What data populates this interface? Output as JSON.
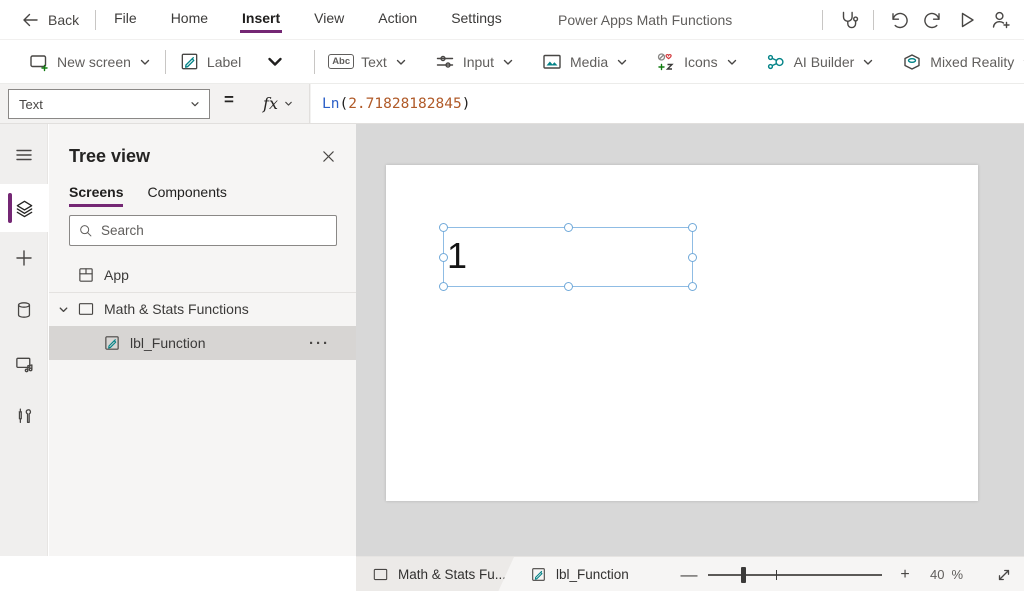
{
  "colors": {
    "accent_purple": "#742774",
    "icon_teal": "#038387",
    "selection_blue": "#70a9d9",
    "formula_function_blue": "#2b5fc7",
    "formula_number_orange": "#b05a28",
    "canvas_gray": "#d8d8d8"
  },
  "menubar": {
    "back_label": "Back",
    "items": [
      {
        "label": "File"
      },
      {
        "label": "Home"
      },
      {
        "label": "Insert",
        "active": true
      },
      {
        "label": "View"
      },
      {
        "label": "Action"
      },
      {
        "label": "Settings"
      }
    ],
    "title": "Power Apps Math Functions"
  },
  "ribbon": {
    "new_screen_label": "New screen",
    "label_label": "Label",
    "abc_glyph": "Abc",
    "text_label": "Text",
    "input_label": "Input",
    "media_label": "Media",
    "icons_label": "Icons",
    "ai_builder_label": "AI Builder",
    "mixed_reality_label": "Mixed Reality"
  },
  "formula_bar": {
    "property_selected": "Text",
    "equals_sign": "=",
    "fx_label": "fx",
    "formula": {
      "function": "Ln",
      "open_paren": "(",
      "number": "2.71828182845",
      "close_paren": ")"
    }
  },
  "tree_panel": {
    "title": "Tree view",
    "tabs": [
      {
        "label": "Screens",
        "active": true
      },
      {
        "label": "Components"
      }
    ],
    "search_placeholder": "Search",
    "items": {
      "app_label": "App",
      "screen_label": "Math & Stats Functions",
      "control_label": "lbl_Function"
    },
    "more_glyph": "···"
  },
  "canvas": {
    "label_value": "1"
  },
  "status_bar": {
    "screen_crumb": "Math & Stats Fu...",
    "control_crumb": "lbl_Function",
    "zoom_out_glyph": "—",
    "zoom_in_glyph": "+",
    "zoom_value": "40",
    "percent_sign": "%"
  }
}
